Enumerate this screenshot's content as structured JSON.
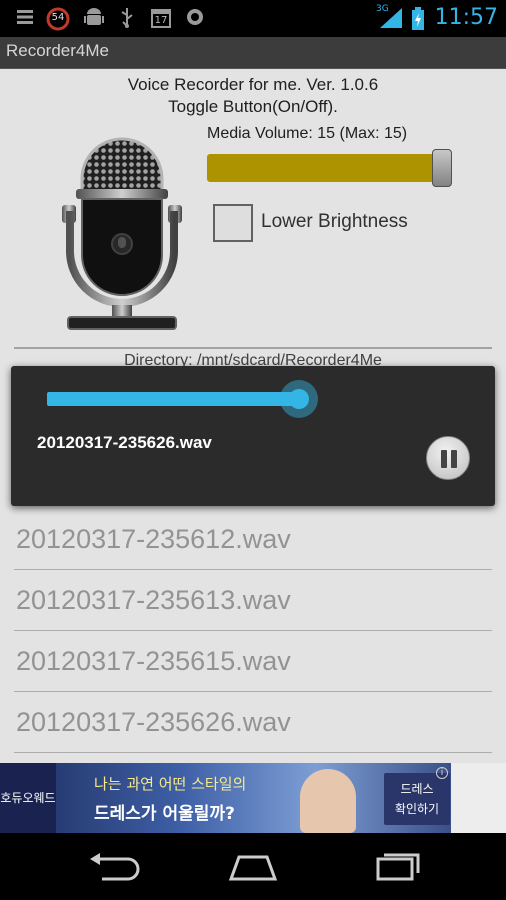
{
  "status_bar": {
    "notification_badge": "54",
    "calendar_day": "17",
    "network_type": "3G",
    "time": "11:57",
    "icons": [
      "list-icon",
      "notification-badge-icon",
      "android-icon",
      "usb-icon",
      "calendar-icon",
      "chat-icon",
      "signal-icon",
      "battery-icon"
    ]
  },
  "app": {
    "title": "Recorder4Me"
  },
  "header": {
    "version_line": "Voice Recorder for me. Ver. 1.0.6",
    "toggle_line": "Toggle Button(On/Off)."
  },
  "volume": {
    "label": "Media Volume: 15 (Max: 15)",
    "value": 15,
    "max": 15
  },
  "brightness": {
    "label": "Lower Brightness",
    "checked": false
  },
  "directory": {
    "text": "Directory: /mnt/sdcard/Recorder4Me"
  },
  "files": [
    "20120317-235612.wav",
    "20120317-235613.wav",
    "20120317-235615.wav",
    "20120317-235626.wav"
  ],
  "player": {
    "track_name": "20120317-235626.wav",
    "progress_fraction": 0.93,
    "state": "playing"
  },
  "ad": {
    "logo_text": "호듀오웨드",
    "line1": "나는 과연 어떤 스타일의",
    "line2": "드레스가 어울릴까?",
    "cta_line1": "드레스",
    "cta_line2": "확인하기",
    "info": "i"
  },
  "colors": {
    "accent": "#33b5e5",
    "volume_track": "#b59a00",
    "background": "#ededed"
  }
}
